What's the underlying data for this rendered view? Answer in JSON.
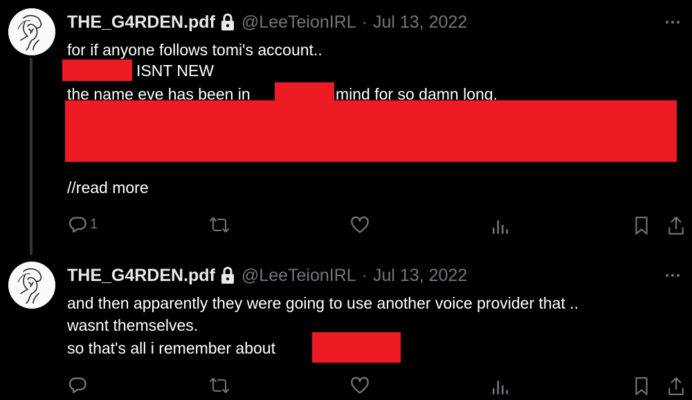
{
  "tweets": [
    {
      "display_name": "THE_G4RDEN.pdf",
      "handle": "@LeeTeionIRL",
      "separator": "·",
      "date": "Jul 13, 2022",
      "lines": [
        "for if anyone follows tomi's account..",
        "ISNT NEW",
        "the name eve has been in",
        "mind for so damn long."
      ],
      "read_more": "//read more",
      "reply_count": "1"
    },
    {
      "display_name": "THE_G4RDEN.pdf",
      "handle": "@LeeTeionIRL",
      "separator": "·",
      "date": "Jul 13, 2022",
      "lines": [
        "and then apparently they were going to use another voice provider that ..",
        "wasnt themselves.",
        "so that's all i remember about"
      ],
      "reply_count": ""
    }
  ],
  "icons": {
    "lock": "lock-icon",
    "more": "more-icon",
    "reply": "reply-icon",
    "retweet": "retweet-icon",
    "like": "like-icon",
    "views": "views-icon",
    "bookmark": "bookmark-icon",
    "share": "share-icon"
  },
  "colors": {
    "background": "#000000",
    "text": "#e7e9ea",
    "muted": "#71767b",
    "redaction": "#ed1c24",
    "thread_line": "#333639"
  }
}
